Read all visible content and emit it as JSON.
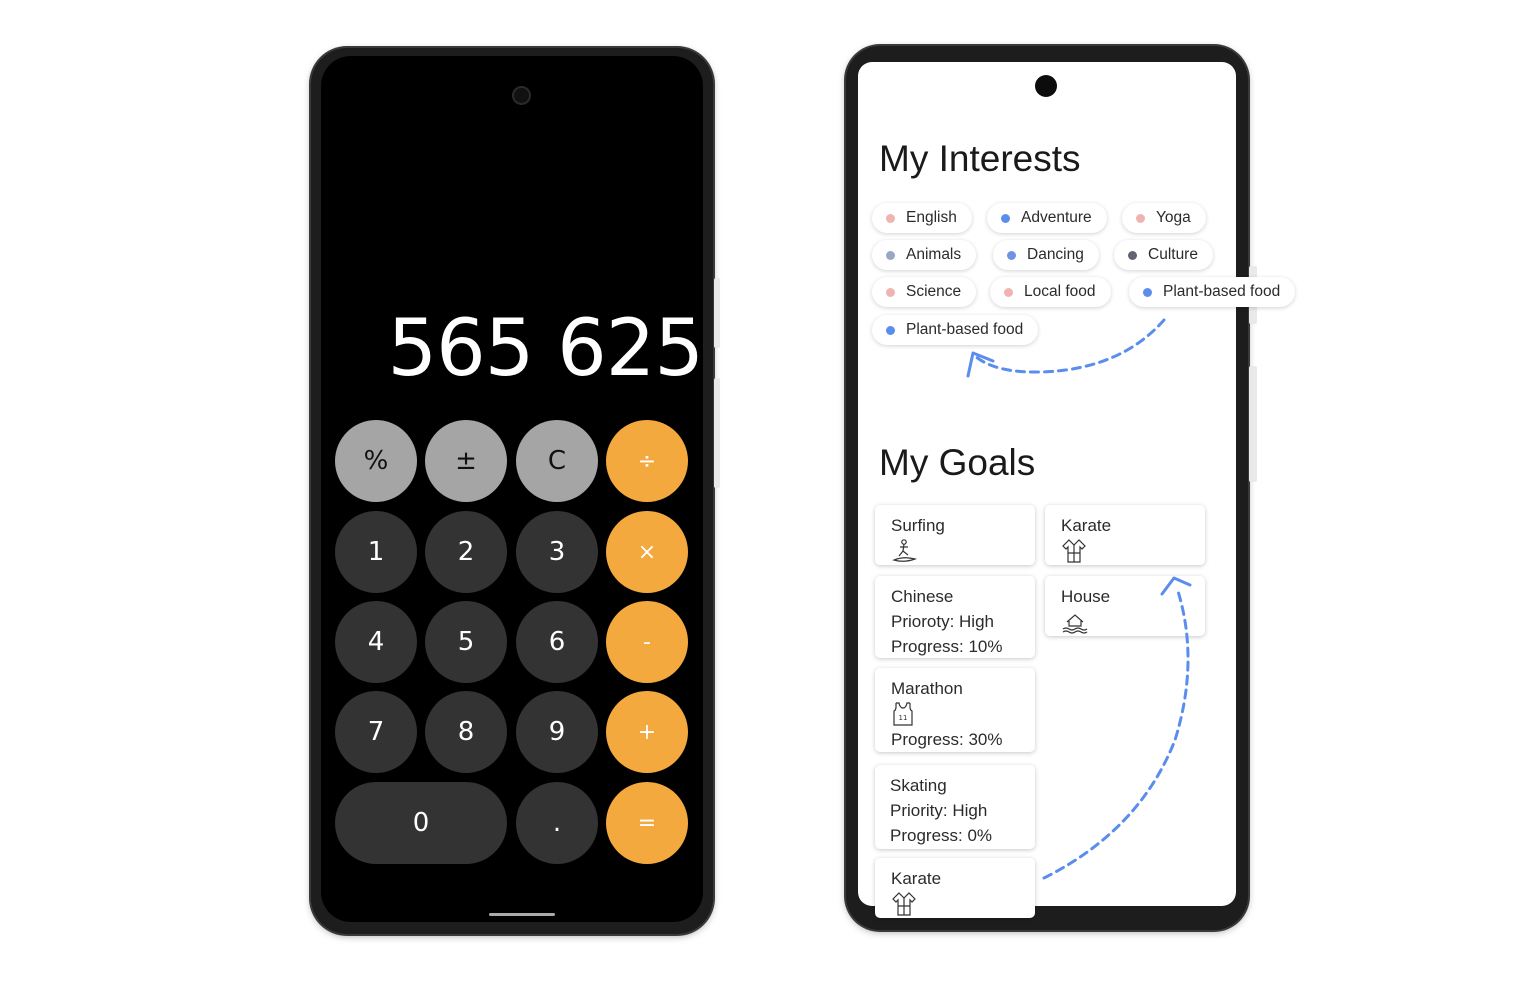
{
  "calculator": {
    "display": "565 625",
    "keys": {
      "percent": "%",
      "plus_minus": "±",
      "clear": "C",
      "divide": "÷",
      "one": "1",
      "two": "2",
      "three": "3",
      "multiply": "×",
      "four": "4",
      "five": "5",
      "six": "6",
      "minus": "-",
      "seven": "7",
      "eight": "8",
      "nine": "9",
      "plus": "+",
      "zero": "0",
      "decimal": ".",
      "equals": "="
    },
    "colors": {
      "function_key": "#a5a5a5",
      "digit_key": "#333333",
      "operator_key": "#f4a93e",
      "background": "#000000"
    }
  },
  "interests": {
    "title": "My Interests",
    "chips": [
      {
        "label": "English",
        "dot_color": "#f0b4b0"
      },
      {
        "label": "Adventure",
        "dot_color": "#5b8def"
      },
      {
        "label": "Yoga",
        "dot_color": "#f0b4b0"
      },
      {
        "label": "Animals",
        "dot_color": "#9aa7c4"
      },
      {
        "label": "Dancing",
        "dot_color": "#6f93e3"
      },
      {
        "label": "Culture",
        "dot_color": "#5f6470"
      },
      {
        "label": "Science",
        "dot_color": "#f0b4b0"
      },
      {
        "label": "Local food",
        "dot_color": "#f0b4b0"
      },
      {
        "label": "Plant-based food",
        "dot_color": "#5b8def"
      },
      {
        "label": "Plant-based food",
        "dot_color": "#5b8def"
      }
    ]
  },
  "goals": {
    "title": "My Goals",
    "cards": [
      {
        "title": "Surfing",
        "icon": "surfer-icon"
      },
      {
        "title": "Karate",
        "icon": "karate-gi-icon"
      },
      {
        "title": "Chinese",
        "priority": "Prioroty: High",
        "progress": "Progress: 10%"
      },
      {
        "title": "House",
        "icon": "house-swim-icon"
      },
      {
        "title": "Marathon",
        "icon": "runner-jersey-icon",
        "progress": "Progress: 30%"
      },
      {
        "title": "Skating",
        "priority": "Priority: High",
        "progress": "Progress: 0%"
      },
      {
        "title": "Karate",
        "icon": "karate-gi-icon"
      }
    ]
  },
  "arrow_color": "#5b8def"
}
